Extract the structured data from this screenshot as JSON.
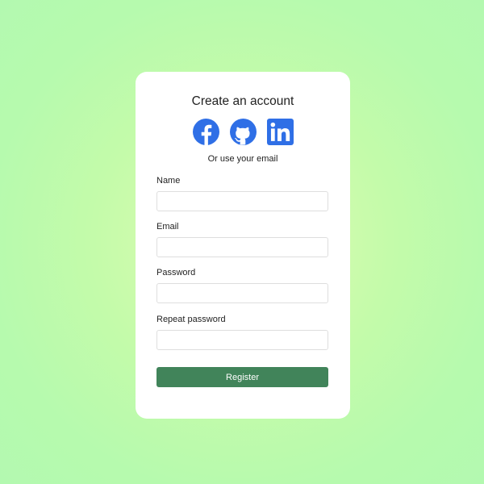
{
  "form": {
    "title": "Create an account",
    "social": [
      {
        "name": "facebook",
        "icon": "facebook-icon"
      },
      {
        "name": "github",
        "icon": "github-icon"
      },
      {
        "name": "linkedin",
        "icon": "linkedin-icon"
      }
    ],
    "alt_text": "Or use your email",
    "fields": {
      "name": {
        "label": "Name",
        "value": "",
        "placeholder": ""
      },
      "email": {
        "label": "Email",
        "value": "",
        "placeholder": ""
      },
      "password": {
        "label": "Password",
        "value": "",
        "placeholder": ""
      },
      "repeat_password": {
        "label": "Repeat password",
        "value": "",
        "placeholder": ""
      }
    },
    "submit_label": "Register"
  },
  "colors": {
    "social_blue": "#2f6fe6",
    "button_green": "#41845a",
    "background_green": "#b6faae",
    "background_center": "#e6fbb0"
  }
}
